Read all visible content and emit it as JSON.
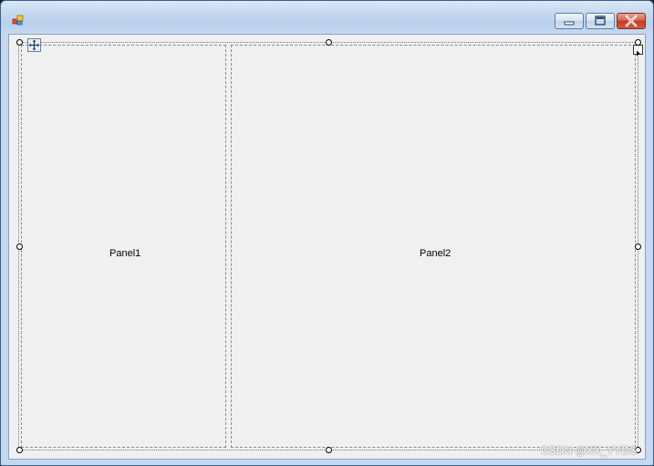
{
  "window": {
    "title_icon": "winforms-app-icon",
    "buttons": {
      "minimize_icon": "minimize-icon",
      "maximize_icon": "maximize-icon",
      "close_icon": "close-icon"
    }
  },
  "designer": {
    "move_glyph_icon": "move-arrows-icon",
    "smart_tag_icon": "smart-tag-arrow-icon",
    "panels": [
      {
        "label": "Panel1"
      },
      {
        "label": "Panel2"
      }
    ]
  },
  "watermark": "CSDN @XX_YYDS",
  "colors": {
    "title_bar": "#c7daf1",
    "client_bg": "#f0f0f0",
    "close_button": "#c33a22"
  }
}
